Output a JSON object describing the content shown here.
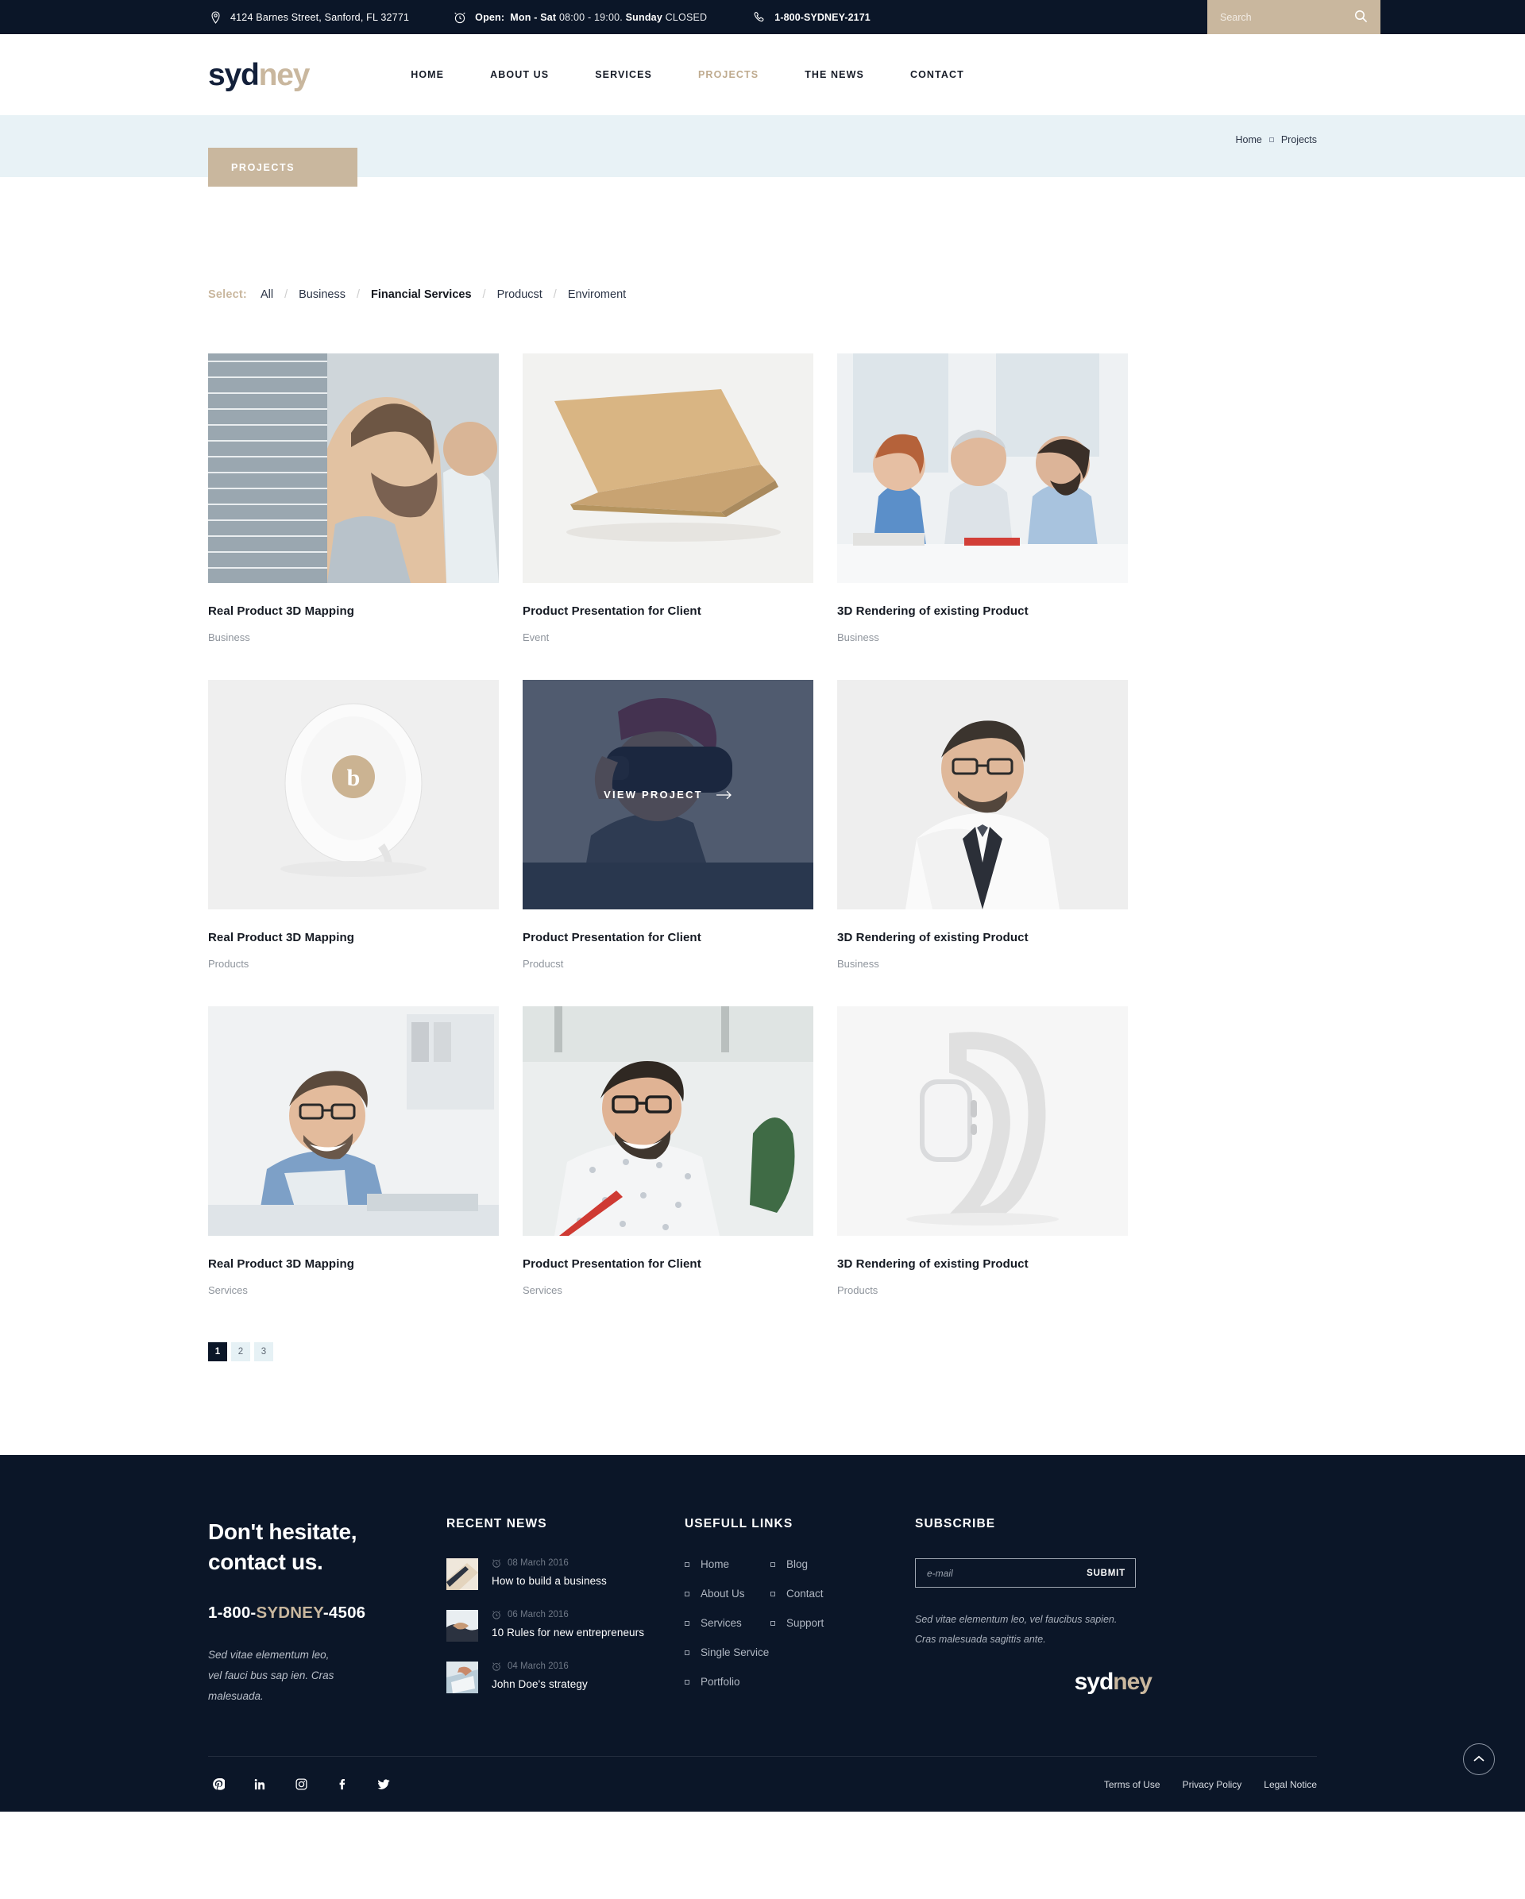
{
  "topbar": {
    "address_icon": "map-pin-icon",
    "address": "4124 Barnes Street, Sanford, FL 32771",
    "hours_icon": "alarm-clock-icon",
    "hours_label": "Open:",
    "hours_days": "Mon - Sat",
    "hours_time": "08:00 - 19:00.",
    "hours_sunday_label": "Sunday",
    "hours_sunday_value": "CLOSED",
    "phone_icon": "phone-icon",
    "phone": "1-800-SYDNEY-2171",
    "search_placeholder": "Search",
    "search_value": "",
    "search_icon": "search-icon",
    "bar_color": "#0b1628",
    "search_bg": "#c9b79e"
  },
  "header": {
    "logo_part1": "syd",
    "logo_part2": "ney",
    "nav": [
      {
        "label": "HOME",
        "active": false
      },
      {
        "label": "ABOUT US",
        "active": false
      },
      {
        "label": "SERVICES",
        "active": false
      },
      {
        "label": "PROJECTS",
        "active": true
      },
      {
        "label": "THE NEWS",
        "active": false
      },
      {
        "label": "CONTACT",
        "active": false
      }
    ],
    "accent": "#c9b79e"
  },
  "hero": {
    "page_title": "PROJECTS",
    "breadcrumb_home": "Home",
    "breadcrumb_current": "Projects",
    "band_color": "#e8f2f6"
  },
  "filters": {
    "label": "Select:",
    "items": [
      {
        "label": "All",
        "active": false
      },
      {
        "label": "Business",
        "active": false
      },
      {
        "label": "Financial Services",
        "active": true
      },
      {
        "label": "Producst",
        "active": false
      },
      {
        "label": "Enviroment",
        "active": false
      }
    ],
    "separator": "/"
  },
  "projects": {
    "overlay_label": "VIEW PROJECT",
    "items": [
      {
        "title": "Real Product 3D Mapping",
        "category": "Business",
        "image": "bearded-man-plaid-shirt-photo",
        "overlay": false
      },
      {
        "title": "Product Presentation for Client",
        "category": "Event",
        "image": "gold-laptop-photo",
        "overlay": false
      },
      {
        "title": "3D Rendering of existing Product",
        "category": "Business",
        "image": "office-team-meeting-photo",
        "overlay": false
      },
      {
        "title": "Real Product 3D Mapping",
        "category": "Products",
        "image": "beats-pill-speaker-photo",
        "overlay": false
      },
      {
        "title": "Product Presentation for Client",
        "category": "Producst",
        "image": "vr-headset-woman-photo",
        "overlay": true
      },
      {
        "title": "3D Rendering of existing Product",
        "category": "Business",
        "image": "businessman-tie-portrait-photo",
        "overlay": false
      },
      {
        "title": "Real Product 3D Mapping",
        "category": "Services",
        "image": "handshake-office-photo",
        "overlay": false
      },
      {
        "title": "Product Presentation for Client",
        "category": "Services",
        "image": "bearded-man-glasses-writing-photo",
        "overlay": false
      },
      {
        "title": "3D Rendering of existing Product",
        "category": "Products",
        "image": "smart-watch-photo",
        "overlay": false
      }
    ]
  },
  "pagination": {
    "pages": [
      "1",
      "2",
      "3"
    ],
    "current": "1"
  },
  "footer": {
    "contact": {
      "heading_line1": "Don't hesitate,",
      "heading_line2": "contact us.",
      "phone_prefix": "1-800-",
      "phone_highlight": "SYDNEY",
      "phone_suffix": "-4506",
      "note_line1": "Sed vitae elementum leo,",
      "note_line2": "vel fauci bus sap ien. Cras",
      "note_line3": "malesuada."
    },
    "news": {
      "heading": "RECENT NEWS",
      "date_icon": "clock-icon",
      "items": [
        {
          "date": "08 March 2016",
          "title": "How to build a business",
          "thumb": "laptop-thumb"
        },
        {
          "date": "06 March 2016",
          "title": "10 Rules for new entrepreneurs",
          "thumb": "handshake-thumb"
        },
        {
          "date": "04 March 2016",
          "title": "John Doe's strategy",
          "thumb": "tablet-thumb"
        }
      ]
    },
    "links": {
      "heading": "USEFULL LINKS",
      "column1": [
        "Home",
        "About Us",
        "Services",
        "Single Service",
        "Portfolio"
      ],
      "column2": [
        "Blog",
        "Contact",
        "Support"
      ]
    },
    "subscribe": {
      "heading": "SUBSCRIBE",
      "input_placeholder": "e-mail",
      "input_value": "",
      "submit_label": "SUBMIT",
      "note_line1": "Sed vitae elementum leo, vel faucibus sapien.",
      "note_line2": "Cras malesuada sagittis ante.",
      "logo_part1": "syd",
      "logo_part2": "ney"
    },
    "socials": [
      {
        "name": "pinterest-icon",
        "glyph": "P"
      },
      {
        "name": "linkedin-icon",
        "glyph": "in"
      },
      {
        "name": "instagram-icon",
        "glyph": "IG"
      },
      {
        "name": "facebook-icon",
        "glyph": "f"
      },
      {
        "name": "twitter-icon",
        "glyph": "t"
      }
    ],
    "legal": [
      "Terms of Use",
      "Privacy Policy",
      "Legal Notice"
    ],
    "to_top_icon": "chevron-up-icon",
    "bg_color": "#0b1628"
  }
}
